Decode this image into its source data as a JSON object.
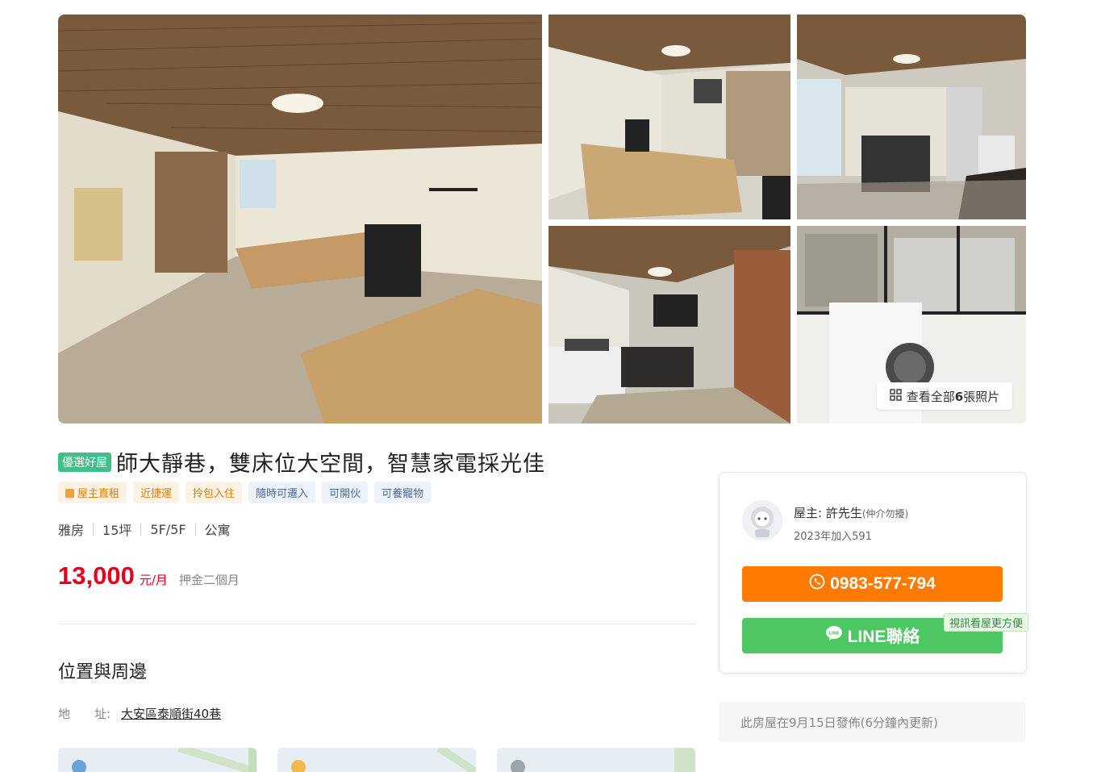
{
  "gallery": {
    "photos": [
      {
        "name": "bedroom-main-photo"
      },
      {
        "name": "room-with-bed-photo"
      },
      {
        "name": "kitchen-sofa-photo"
      },
      {
        "name": "kitchen-living-photo"
      },
      {
        "name": "washing-machine-balcony-photo"
      }
    ],
    "view_all_prefix": "查看全部",
    "view_all_count": "6",
    "view_all_suffix": "張照片"
  },
  "listing": {
    "premium_badge": "優選好屋",
    "title": "師大靜巷，雙床位大空間，智慧家電採光佳",
    "tags": [
      {
        "label": "屋主直租",
        "style": "orange"
      },
      {
        "label": "近捷運",
        "style": "orange"
      },
      {
        "label": "拎包入住",
        "style": "orange"
      },
      {
        "label": "隨時可遷入",
        "style": "blue"
      },
      {
        "label": "可開伙",
        "style": "blue"
      },
      {
        "label": "可養寵物",
        "style": "blue"
      }
    ],
    "specs": [
      "雅房",
      "15坪",
      "5F/5F",
      "公寓"
    ],
    "price": "13,000",
    "price_unit": "元/月",
    "deposit": "押金二個月"
  },
  "location": {
    "section_title": "位置與周邊",
    "address_label": "地　　址:",
    "address_value": "大安區泰順街40巷"
  },
  "contact": {
    "owner_label": "屋主: 許先生",
    "owner_note": "(仲介勿擾)",
    "joined": "2023年加入591",
    "phone": "0983-577-794",
    "line_label": "LINE聯絡",
    "video_tip": "視訊看屋更方便"
  },
  "posted_info": "此房屋在9月15日發佈(6分鐘內更新)",
  "colors": {
    "price": "#e6001e",
    "phone_button": "#ff7a00",
    "line_button": "#4cc764",
    "premium_badge": "#3fbf8a"
  }
}
